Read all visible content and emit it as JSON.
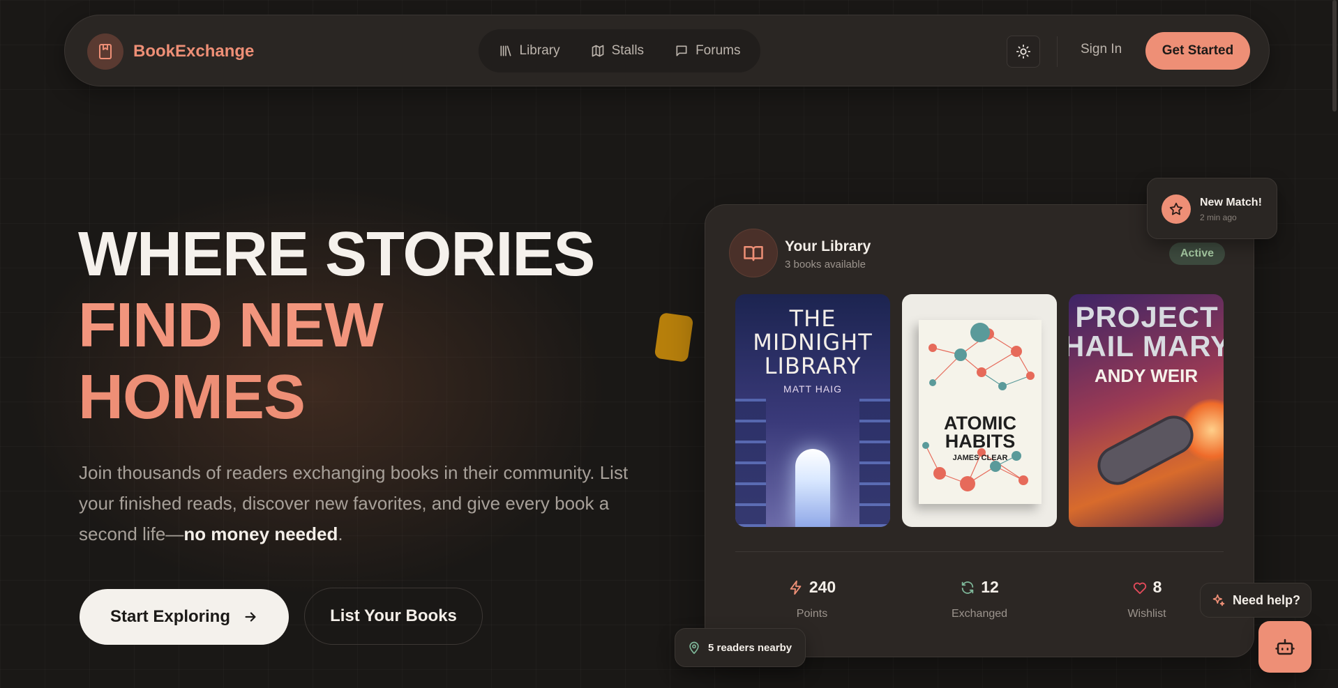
{
  "nav": {
    "brand": "BookExchange",
    "links": [
      {
        "label": "Library",
        "icon": "library-icon"
      },
      {
        "label": "Stalls",
        "icon": "map-icon"
      },
      {
        "label": "Forums",
        "icon": "message-icon"
      }
    ],
    "theme_icon": "sun-icon",
    "signin": "Sign In",
    "cta": "Get Started"
  },
  "hero": {
    "line1": "WHERE STORIES",
    "line2": "FIND NEW",
    "line3": "HOMES",
    "desc_before": "Join thousands of readers exchanging books in their community. List your finished reads, discover new favorites, and give every book a second life—",
    "desc_bold": "no money needed",
    "desc_after": ".",
    "primary": "Start Exploring",
    "secondary": "List Your Books"
  },
  "card": {
    "title": "Your Library",
    "subtitle": "3 books available",
    "badge": "Active",
    "books": [
      {
        "title": "THE MIDNIGHT LIBRARY",
        "author": "MATT HAIG"
      },
      {
        "title": "ATOMIC HABITS",
        "author": "JAMES CLEAR"
      },
      {
        "title": "PROJECT HAIL MARY",
        "author": "ANDY WEIR"
      }
    ],
    "stats": [
      {
        "value": "240",
        "label": "Points",
        "icon": "zap-icon"
      },
      {
        "value": "12",
        "label": "Exchanged",
        "icon": "refresh-icon"
      },
      {
        "value": "8",
        "label": "Wishlist",
        "icon": "heart-icon"
      }
    ]
  },
  "match": {
    "title": "New Match!",
    "time": "2 min ago"
  },
  "nearby": "5 readers nearby",
  "help": "Need help?",
  "colors": {
    "accent": "#ee8f76",
    "background": "#1a1816",
    "surface": "#2a2623",
    "success": "#a8cca4"
  }
}
